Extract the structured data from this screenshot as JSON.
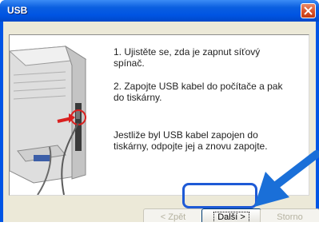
{
  "window": {
    "title": "USB"
  },
  "instructions": {
    "step1": "1. Ujistěte se, zda je zapnut síťový spínač.",
    "step2": "2. Zapojte USB kabel do počítače a pak do tiskárny.",
    "note": "Jestliže byl USB kabel zapojen do tiskárny, odpojte jej a znovu zapojte."
  },
  "buttons": {
    "back": "< Zpět",
    "next": "Další >",
    "cancel": "Storno"
  },
  "colors": {
    "titlebar": "#0054e3",
    "highlight": "#1e5ad6",
    "arrow": "#1a6fd8"
  }
}
